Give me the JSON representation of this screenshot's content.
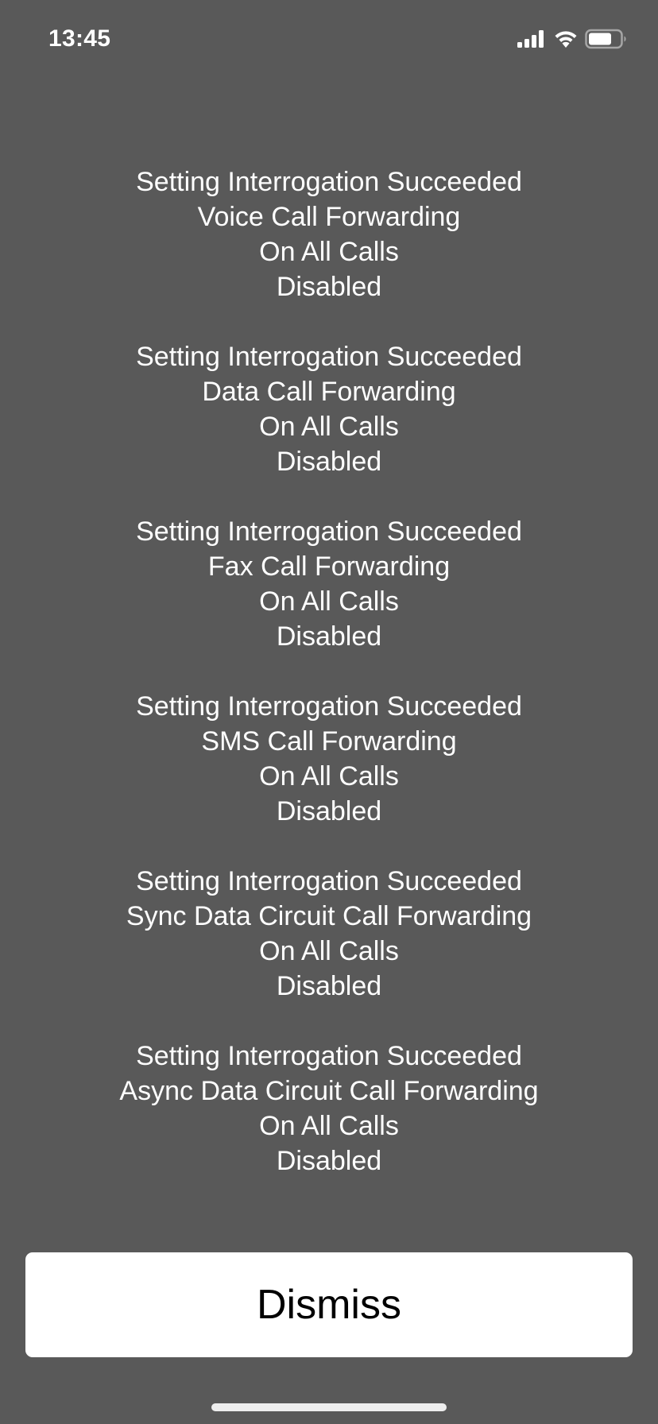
{
  "status_bar": {
    "time": "13:45",
    "icons": [
      "cellular-signal-icon",
      "wifi-icon",
      "battery-icon"
    ]
  },
  "message": {
    "blocks": [
      {
        "lines": [
          "Setting Interrogation Succeeded",
          "Voice Call Forwarding",
          "On All Calls",
          "Disabled"
        ]
      },
      {
        "lines": [
          "Setting Interrogation Succeeded",
          "Data Call Forwarding",
          "On All Calls",
          "Disabled"
        ]
      },
      {
        "lines": [
          "Setting Interrogation Succeeded",
          "Fax Call Forwarding",
          "On All Calls",
          "Disabled"
        ]
      },
      {
        "lines": [
          "Setting Interrogation Succeeded",
          "SMS Call Forwarding",
          "On All Calls",
          "Disabled"
        ]
      },
      {
        "lines": [
          "Setting Interrogation Succeeded",
          "Sync Data Circuit Call Forwarding",
          "On All Calls",
          "Disabled"
        ]
      },
      {
        "lines": [
          "Setting Interrogation Succeeded",
          "Async Data Circuit Call Forwarding",
          "On All Calls",
          "Disabled"
        ]
      }
    ]
  },
  "actions": {
    "dismiss_label": "Dismiss"
  },
  "colors": {
    "background": "#595959",
    "text": "#ffffff",
    "button_background": "#ffffff",
    "button_text": "#000000",
    "home_indicator": "#eeeeee"
  }
}
